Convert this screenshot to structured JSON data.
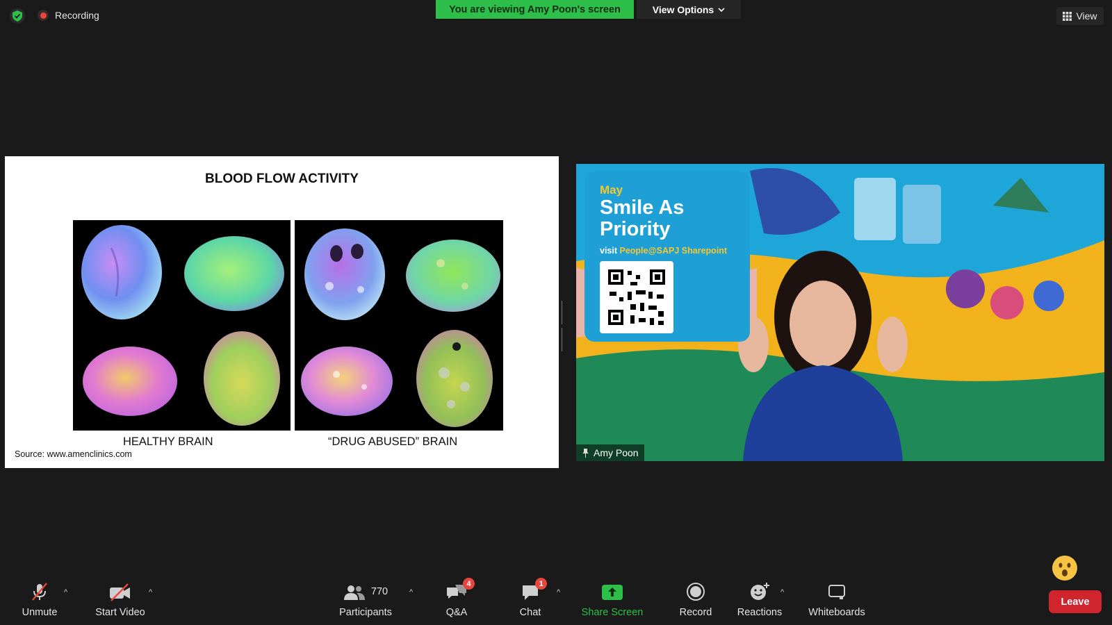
{
  "top": {
    "recording_label": "Recording",
    "banner_text": "You are viewing Amy Poon's screen",
    "view_options_label": "View Options",
    "view_label": "View"
  },
  "slide": {
    "title": "BLOOD FLOW ACTIVITY",
    "caption_left": "HEALTHY BRAIN",
    "caption_right": "“DRUG ABUSED” BRAIN",
    "source": "Source: www.amenclinics.com"
  },
  "video": {
    "participant_name": "Amy Poon",
    "bg_month": "May",
    "bg_title": "Smile As Priority",
    "bg_visit": "visit",
    "bg_link": "People@SAPJ Sharepoint"
  },
  "toolbar": {
    "unmute": "Unmute",
    "start_video": "Start Video",
    "participants": "Participants",
    "participants_count": "770",
    "qa": "Q&A",
    "qa_badge": "4",
    "chat": "Chat",
    "chat_badge": "1",
    "share_screen": "Share Screen",
    "record": "Record",
    "reactions": "Reactions",
    "whiteboards": "Whiteboards",
    "leave": "Leave"
  },
  "colors": {
    "banner_green": "#2ebf4a",
    "leave_red": "#d1252e",
    "background": "#1a1a1a"
  }
}
